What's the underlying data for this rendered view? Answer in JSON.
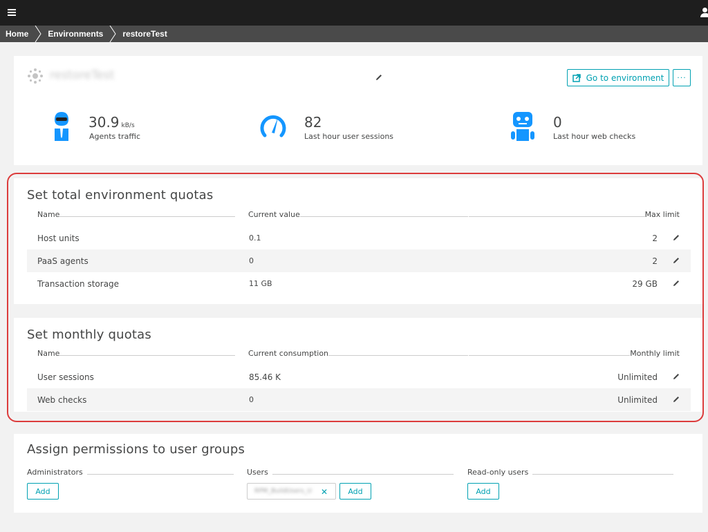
{
  "breadcrumb": [
    "Home",
    "Environments",
    "restoreTest"
  ],
  "environment": {
    "name": "restoreTest",
    "goto_label": "Go to environment",
    "more_label": "···"
  },
  "stats": [
    {
      "value": "30.9",
      "unit": "kB/s",
      "label": "Agents traffic",
      "icon": "agent-icon"
    },
    {
      "value": "82",
      "unit": "",
      "label": "Last hour user sessions",
      "icon": "speedometer-icon"
    },
    {
      "value": "0",
      "unit": "",
      "label": "Last hour web checks",
      "icon": "robot-icon"
    }
  ],
  "total_quotas": {
    "title": "Set total environment quotas",
    "headers": {
      "name": "Name",
      "current": "Current value",
      "limit": "Max limit"
    },
    "rows": [
      {
        "name": "Host units",
        "current": "0.1",
        "limit": "2"
      },
      {
        "name": "PaaS agents",
        "current": "0",
        "limit": "2"
      },
      {
        "name": "Transaction storage",
        "current": "11 GB",
        "limit": "29 GB"
      }
    ]
  },
  "monthly_quotas": {
    "title": "Set monthly quotas",
    "headers": {
      "name": "Name",
      "current": "Current consumption",
      "limit": "Monthly limit"
    },
    "rows": [
      {
        "name": "User sessions",
        "current": "85.46 K",
        "limit": "Unlimited"
      },
      {
        "name": "Web checks",
        "current": "0",
        "limit": "Unlimited"
      }
    ]
  },
  "permissions": {
    "title": "Assign permissions to user groups",
    "groups": [
      {
        "label": "Administrators",
        "add_label": "Add"
      },
      {
        "label": "Users",
        "add_label": "Add",
        "chip": "RPM_BuildUsers_U"
      },
      {
        "label": "Read-only users",
        "add_label": "Add"
      }
    ]
  },
  "colors": {
    "accent": "#00a1b2",
    "highlight": "#dc3c3c",
    "topbar": "#1e1e1e",
    "breadcrumb": "#4a4a4a"
  }
}
